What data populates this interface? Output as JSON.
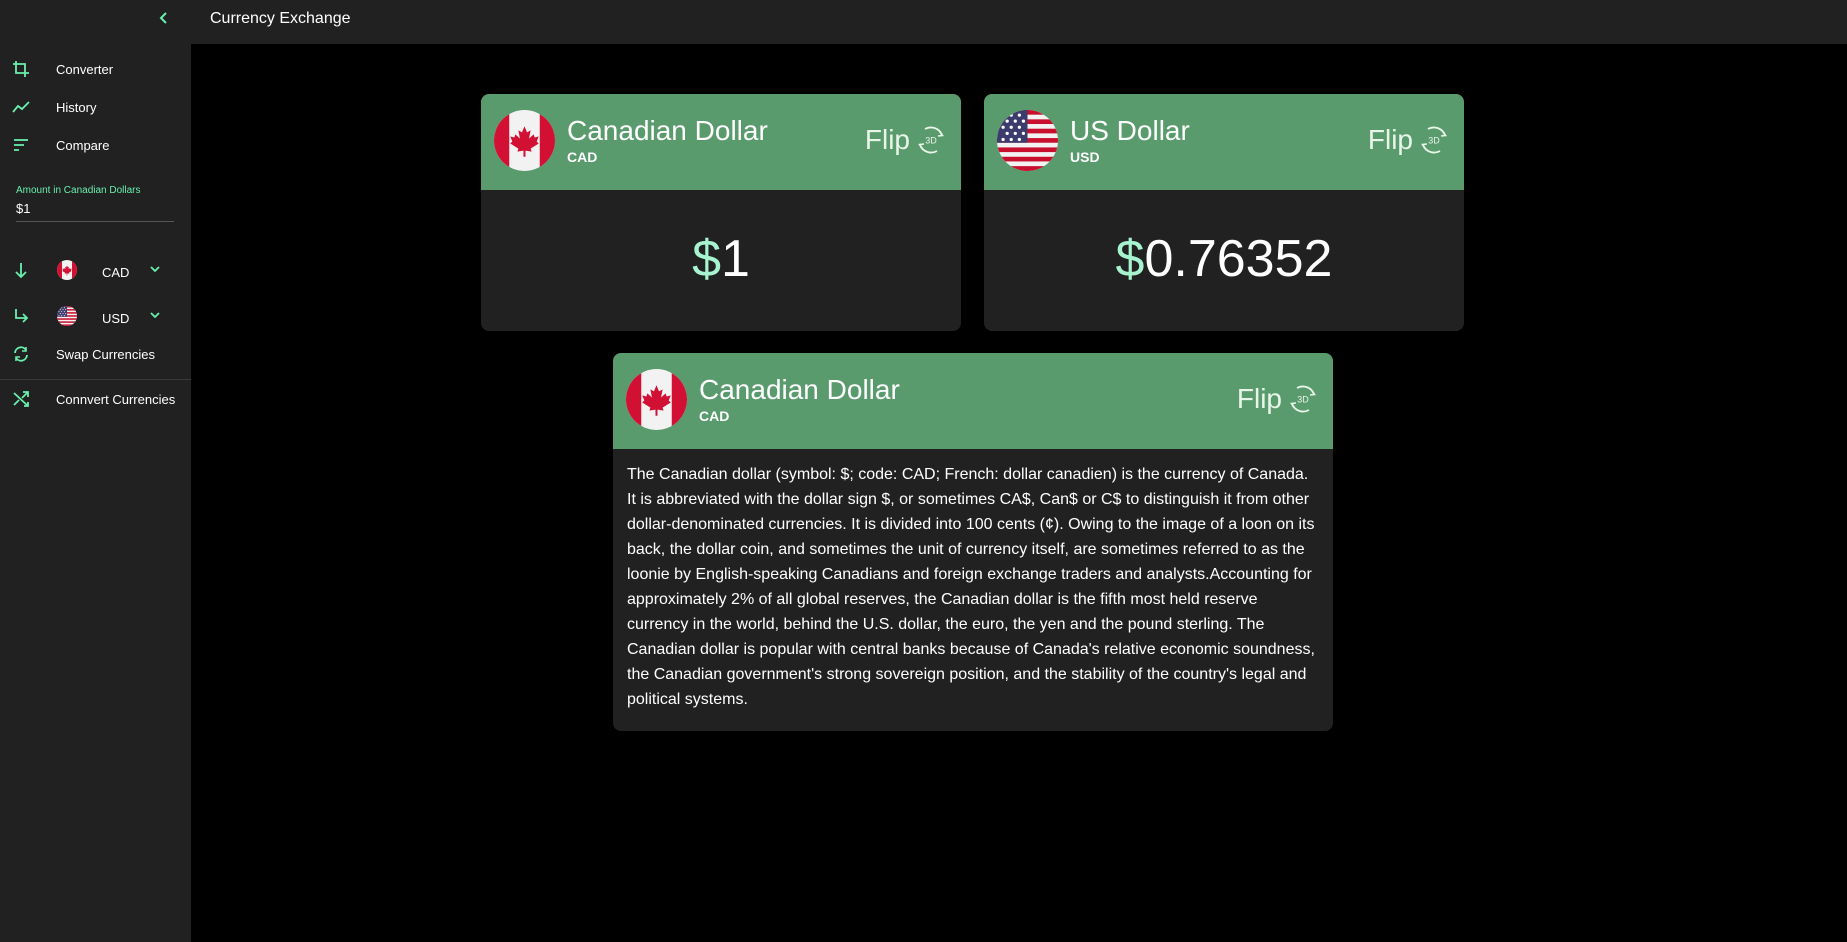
{
  "app": {
    "title": "Currency Exchange"
  },
  "sidebar": {
    "collapse_icon": "chevron-left-icon",
    "nav": [
      {
        "label": "Converter",
        "icon": "crop-icon"
      },
      {
        "label": "History",
        "icon": "trend-line-icon"
      },
      {
        "label": "Compare",
        "icon": "sort-lines-icon"
      }
    ],
    "amount": {
      "label": "Amount in Canadian Dollars",
      "value": "$1"
    },
    "from": {
      "code": "CAD",
      "icon": "arrow-down-icon",
      "flag": "canada-flag-icon"
    },
    "to": {
      "code": "USD",
      "icon": "arrow-turn-right-icon",
      "flag": "us-flag-icon"
    },
    "swap_label": "Swap Currencies",
    "convert_label": "Connvert Currencies"
  },
  "cards": {
    "from": {
      "name": "Canadian Dollar",
      "code": "CAD",
      "symbol": "$",
      "amount": "1",
      "flip": "Flip"
    },
    "to": {
      "name": "US Dollar",
      "code": "USD",
      "symbol": "$",
      "amount": "0.76352",
      "flip": "Flip"
    },
    "info": {
      "name": "Canadian Dollar",
      "code": "CAD",
      "flip": "Flip",
      "description": "The Canadian dollar (symbol: $; code: CAD; French: dollar canadien) is the currency of Canada. It is abbreviated with the dollar sign $, or sometimes CA$, Can$ or C$ to distinguish it from other dollar-denominated currencies. It is divided into 100 cents (¢). Owing to the image of a loon on its back, the dollar coin, and sometimes the unit of currency itself, are sometimes referred to as the loonie by English-speaking Canadians and foreign exchange traders and analysts.Accounting for approximately 2% of all global reserves, the Canadian dollar is the fifth most held reserve currency in the world, behind the U.S. dollar, the euro, the yen and the pound sterling. The Canadian dollar is popular with central banks because of Canada's relative economic soundness, the Canadian government's strong sovereign position, and the stability of the country's legal and political systems."
    }
  },
  "colors": {
    "accent": "#69f0ae",
    "header_green": "#5a9b6e",
    "surface": "#212121",
    "background": "#000000"
  }
}
